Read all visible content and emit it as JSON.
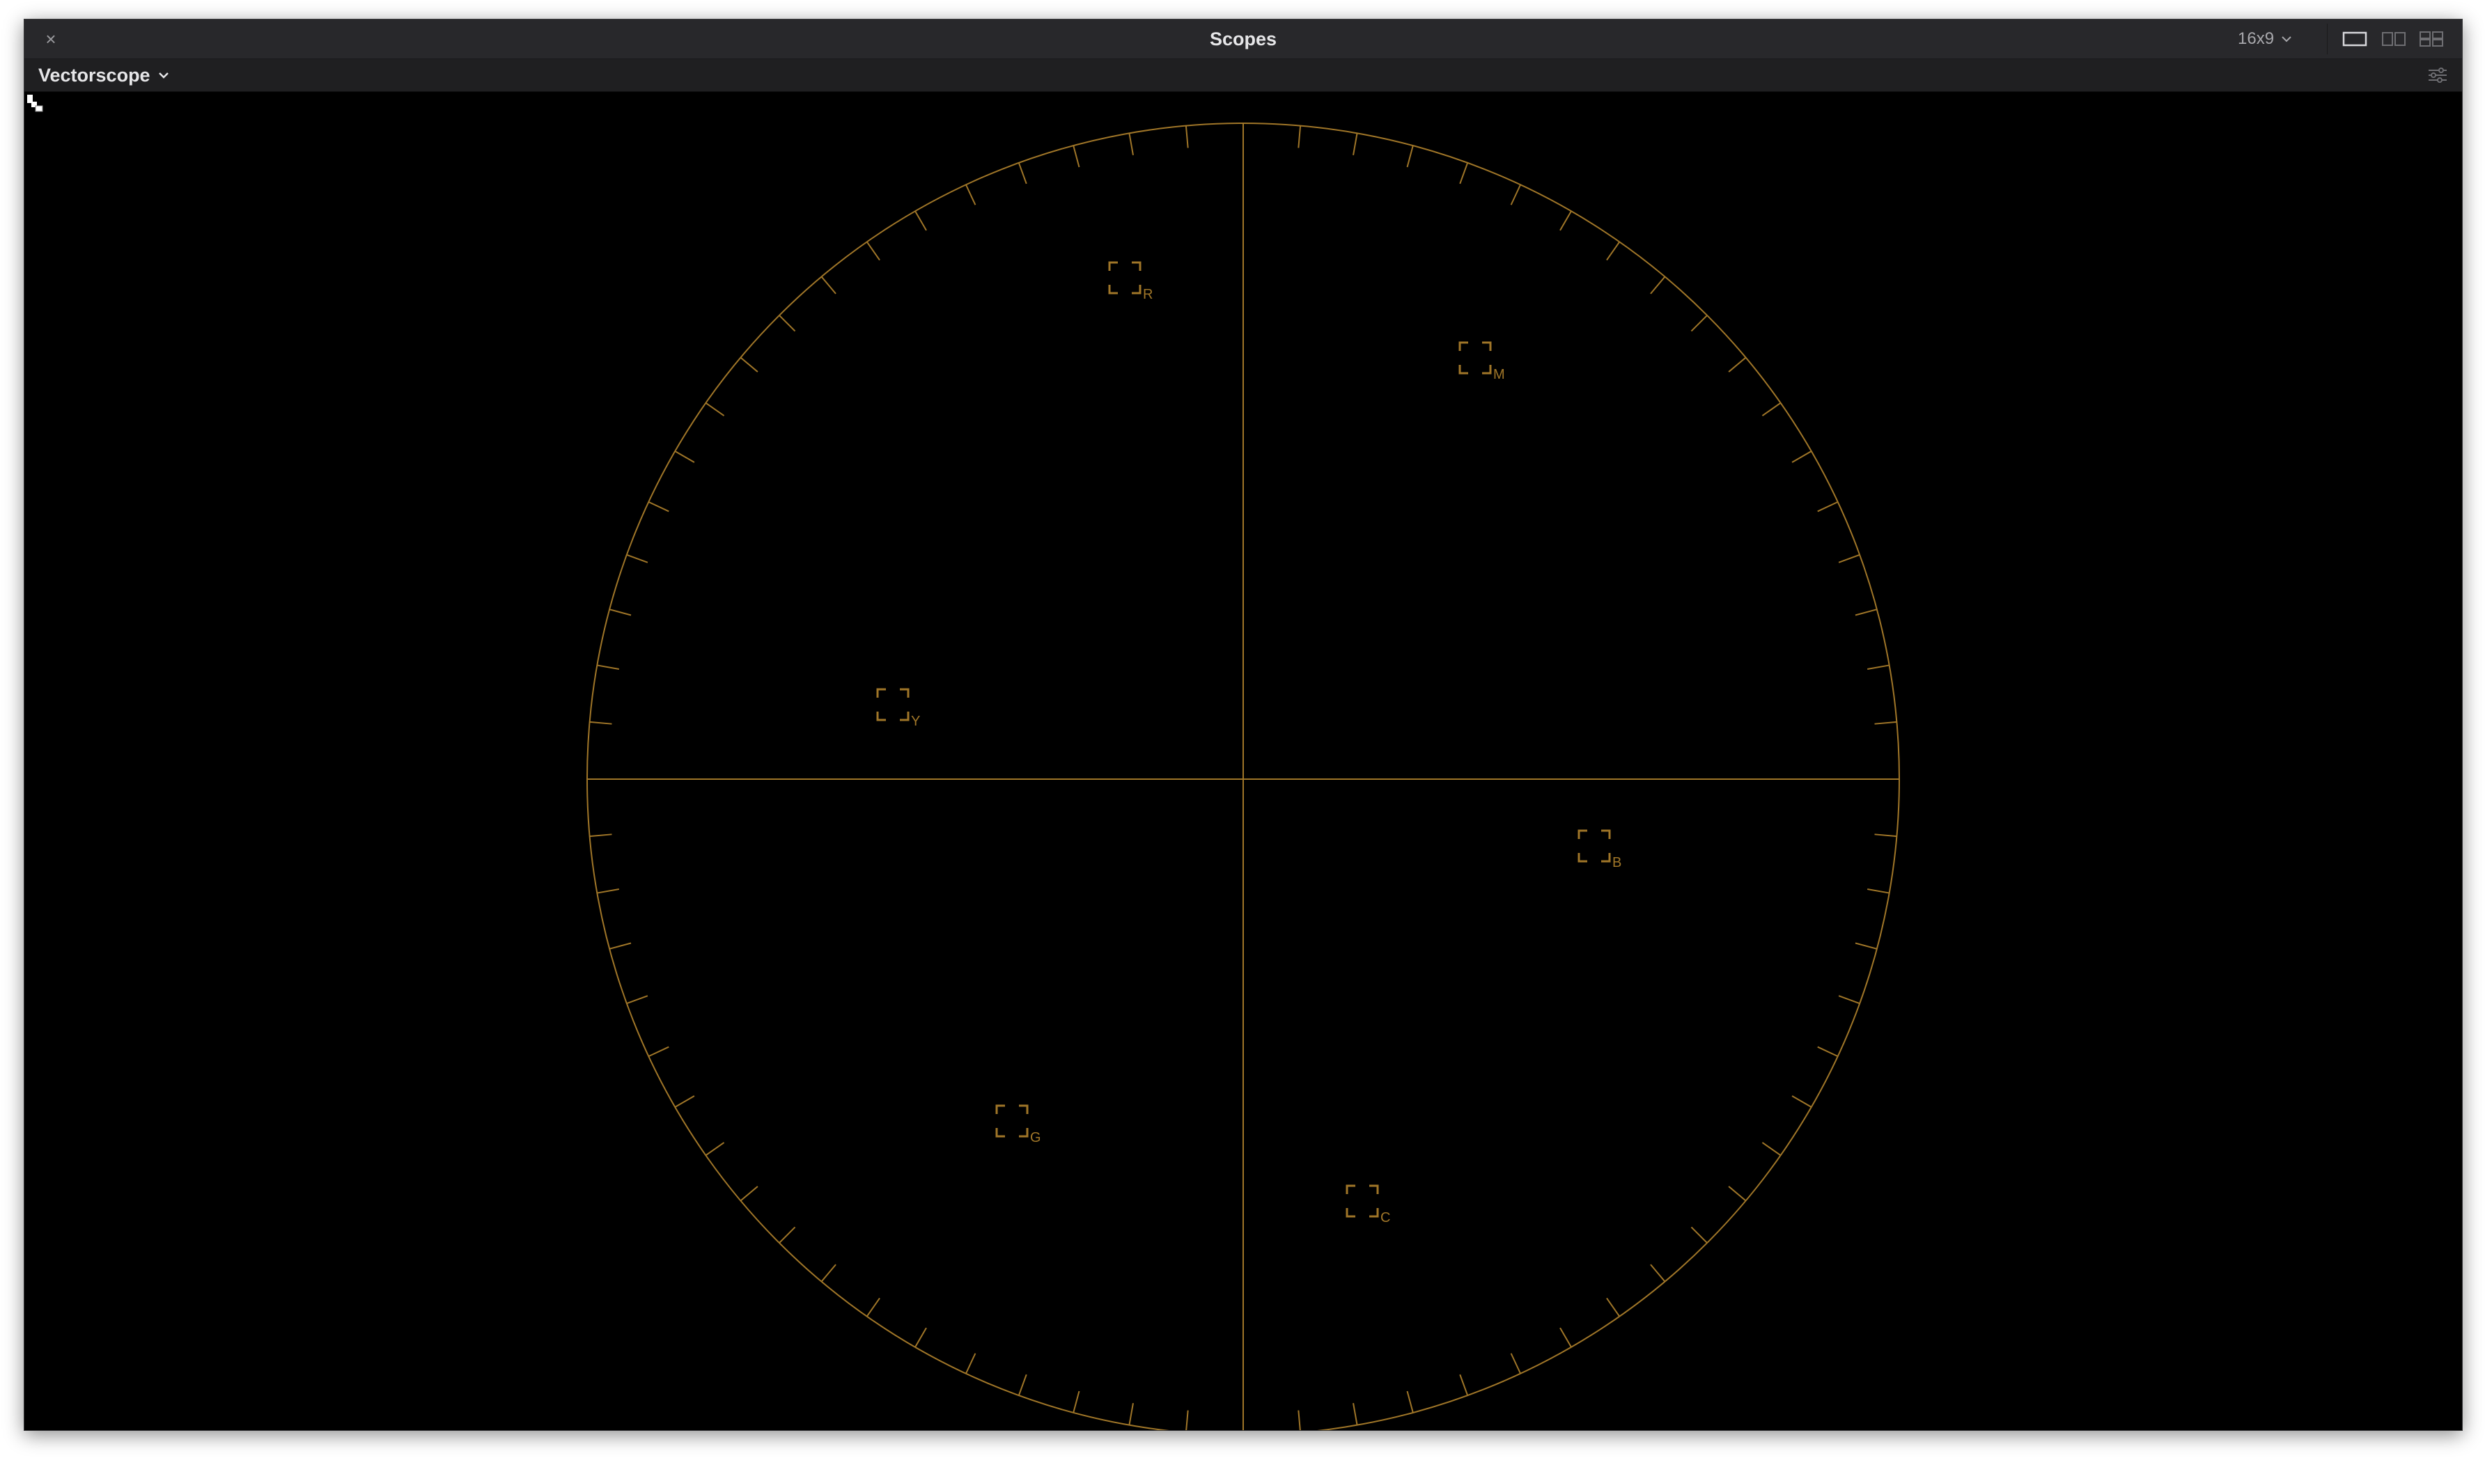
{
  "window": {
    "title": "Scopes",
    "close_glyph": "×"
  },
  "header": {
    "aspect_label": "16x9",
    "layout_options": [
      "single-view-icon",
      "dual-view-icon",
      "quad-view-icon"
    ]
  },
  "toolbar": {
    "scope_type_label": "Vectorscope"
  },
  "vectorscope": {
    "graticule_color": "#a07628",
    "crosshair": true,
    "tick_marks_per_circle": 72,
    "targets": [
      "R",
      "M",
      "B",
      "C",
      "G",
      "Y"
    ]
  },
  "colors": {
    "window_bg": "#000000",
    "titlebar_bg": "#28282b",
    "toolbar_bg": "#1f1f21"
  }
}
